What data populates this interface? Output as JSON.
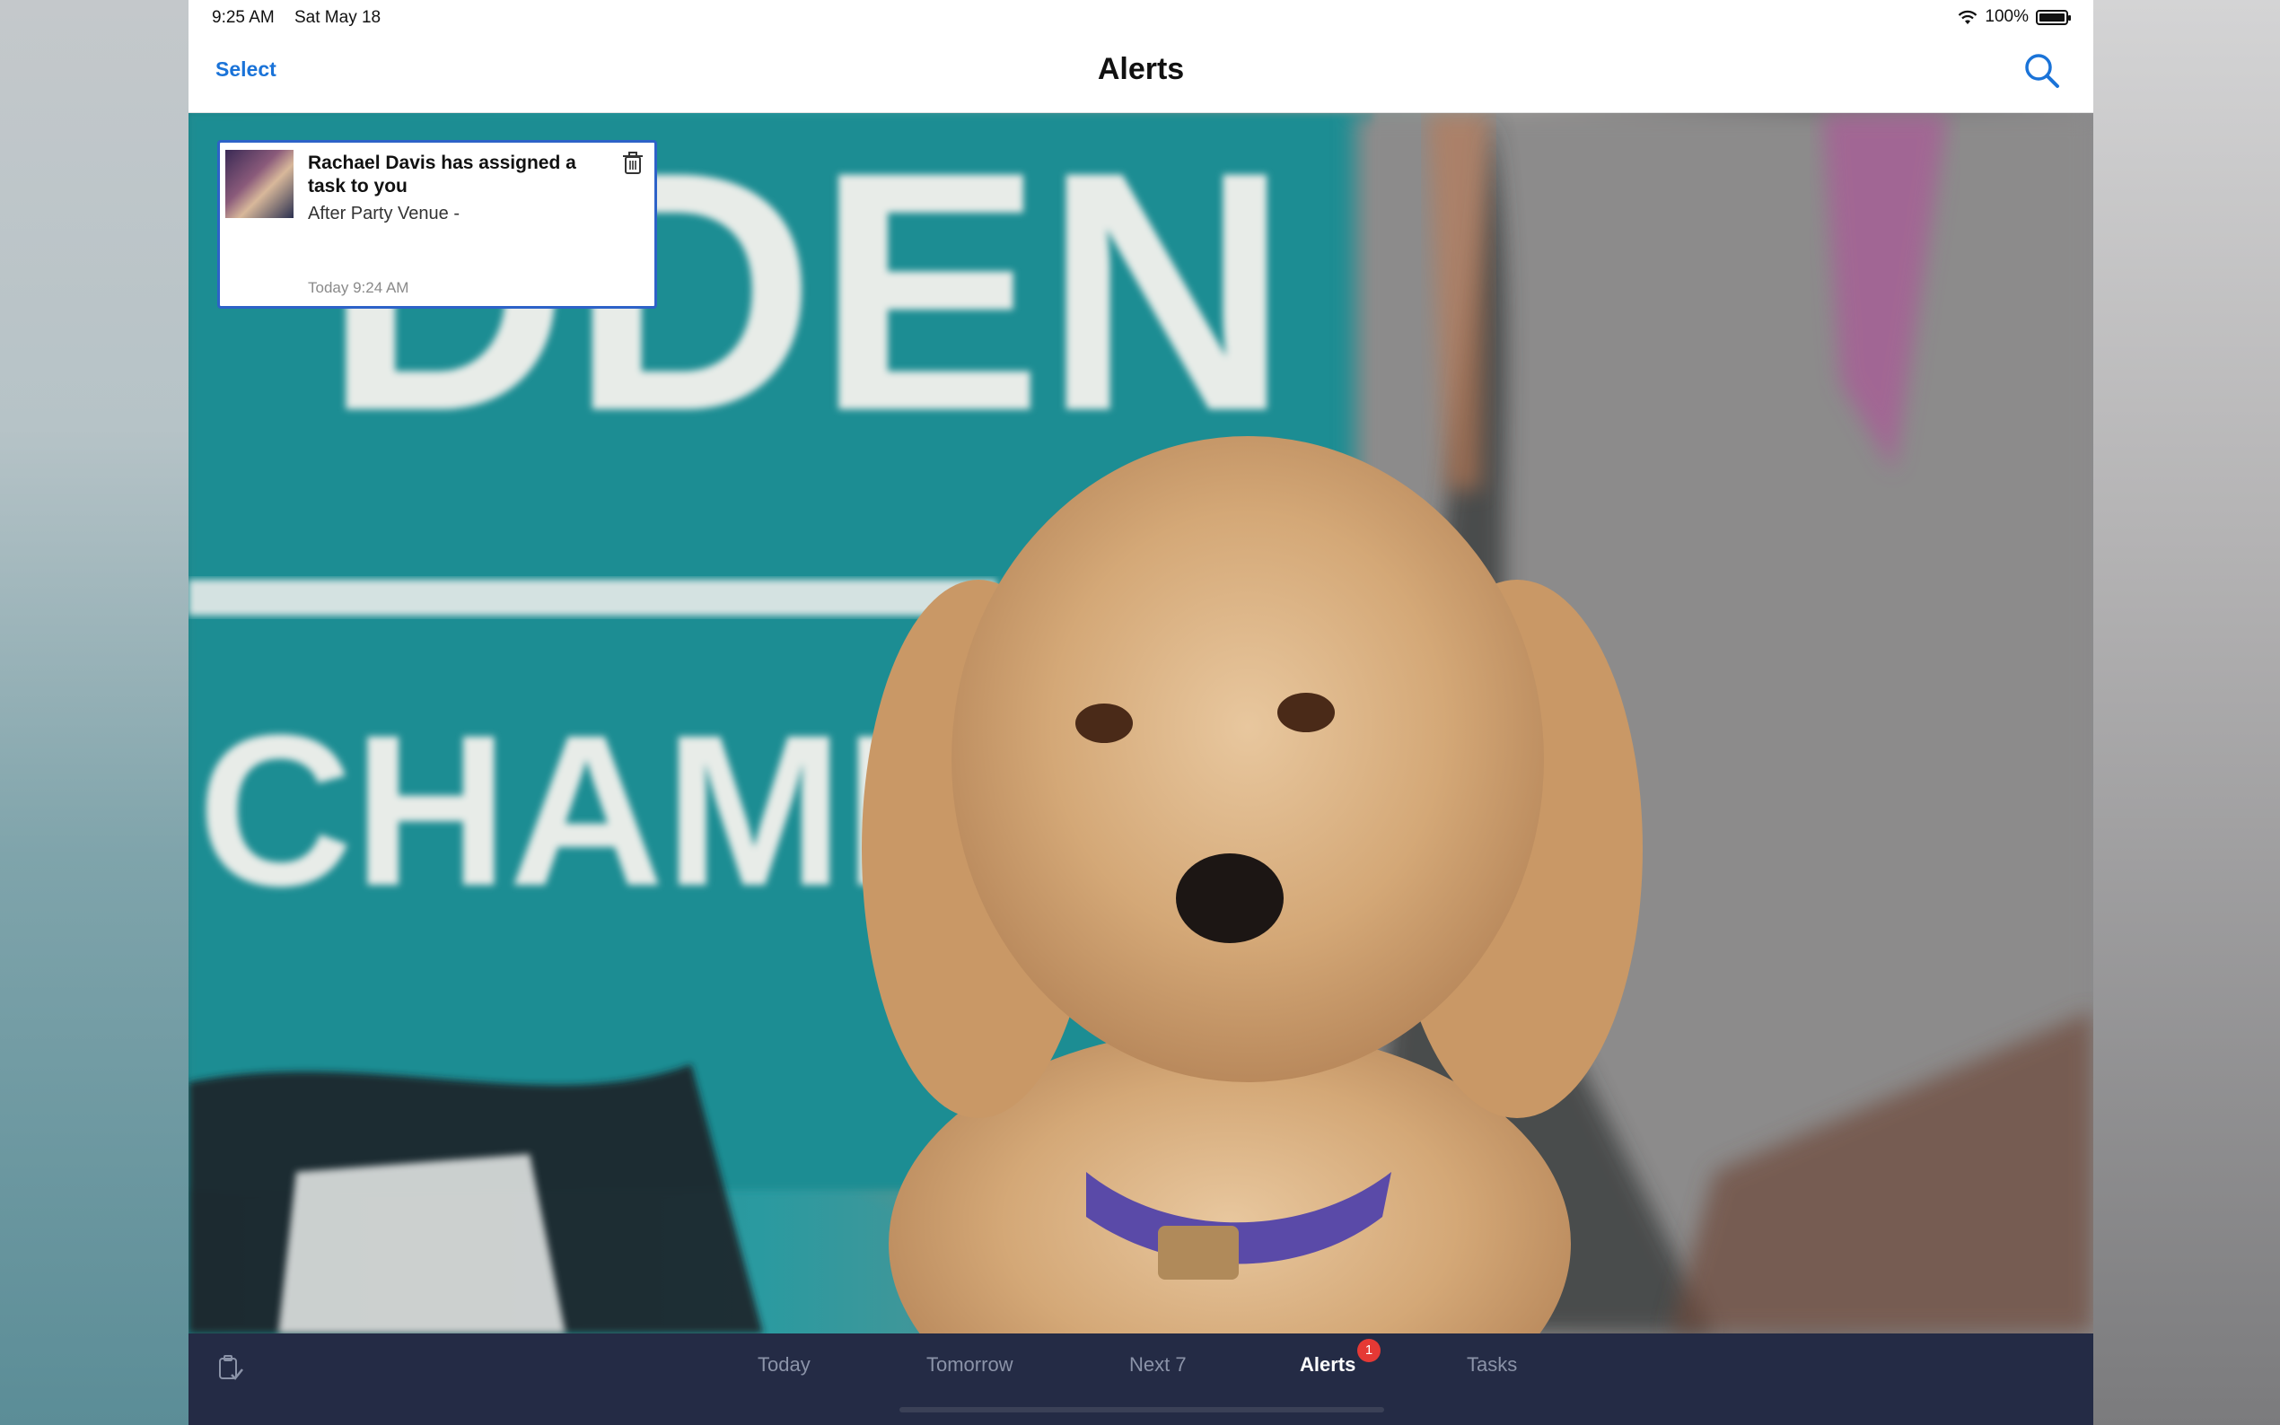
{
  "status_bar": {
    "time": "9:25 AM",
    "date": "Sat May 18",
    "battery": "100%",
    "icons": [
      "wifi-icon",
      "battery-icon"
    ]
  },
  "nav": {
    "select_label": "Select",
    "title": "Alerts",
    "search_icon": "search-icon"
  },
  "alert": {
    "title": "Rachael Davis has assigned a task to you",
    "subtitle": "After Party Venue -",
    "time": "Today 9:24 AM",
    "delete_icon": "trash-icon"
  },
  "tabs": [
    {
      "label": "Today"
    },
    {
      "label": "Tomorrow"
    },
    {
      "label": "Next 7"
    },
    {
      "label": "Alerts",
      "badge": "1",
      "active": true
    },
    {
      "label": "Tasks"
    }
  ],
  "colors": {
    "accent": "#1a73d8",
    "tab_bar": "#242b45",
    "badge": "#e53935",
    "card_border": "#2d62c8"
  }
}
